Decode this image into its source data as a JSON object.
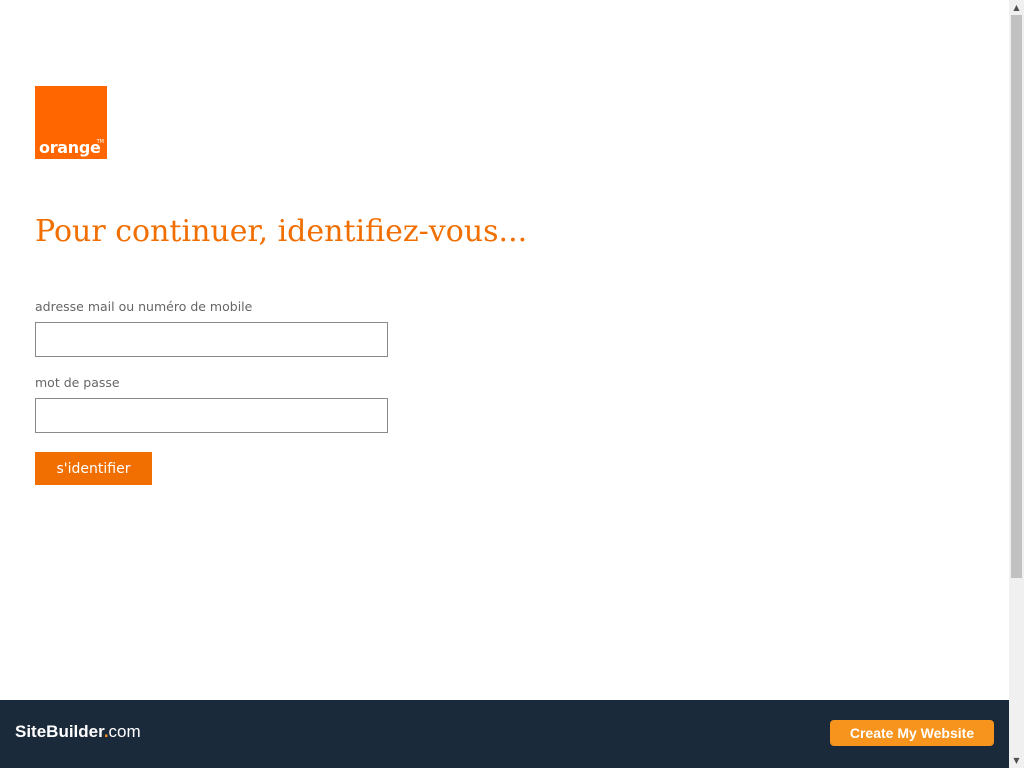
{
  "brand": {
    "logo_text": "orange",
    "logo_tm": "TM",
    "color": "#ff6600"
  },
  "login": {
    "heading": "Pour continuer, identifiez-vous...",
    "email_label": "adresse mail ou numéro de mobile",
    "email_value": "",
    "password_label": "mot de passe",
    "password_value": "",
    "submit_label": "s'identifier",
    "accent_color": "#f16e00"
  },
  "footer": {
    "logo_part1": "SiteBuilder",
    "logo_dot": ".",
    "logo_part2": "com",
    "cta_label": "Create My Website",
    "background_color": "#1b2a3a",
    "cta_color": "#f7941d"
  },
  "scrollbar": {
    "up_icon": "▲",
    "down_icon": "▼"
  }
}
